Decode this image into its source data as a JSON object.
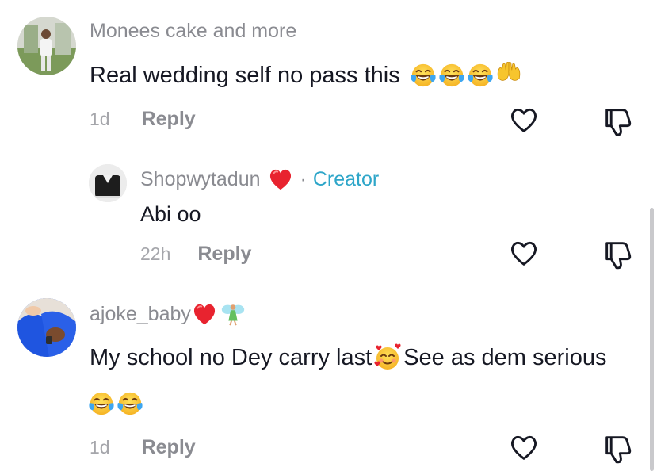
{
  "comments": [
    {
      "username": "Monees cake and more",
      "text": "Real wedding self no pass this",
      "emojis": [
        "laughing-crying",
        "laughing-crying",
        "laughing-crying",
        "raised-hands"
      ],
      "time": "1d",
      "reply_label": "Reply"
    },
    {
      "username": "Shopwytadun",
      "badge": "Creator",
      "text": "Abi oo",
      "time": "22h",
      "reply_label": "Reply"
    },
    {
      "username": "ajoke_baby",
      "text_part1": "My school no Dey carry last",
      "text_part2": "See as dem serious",
      "emojis_line2": [
        "laughing-crying",
        "laughing-crying"
      ],
      "time": "1d",
      "reply_label": "Reply"
    }
  ],
  "colors": {
    "text": "#161823",
    "secondary": "#8a8b91",
    "creator": "#2ea6c9",
    "heart_red": "#e8232f"
  }
}
